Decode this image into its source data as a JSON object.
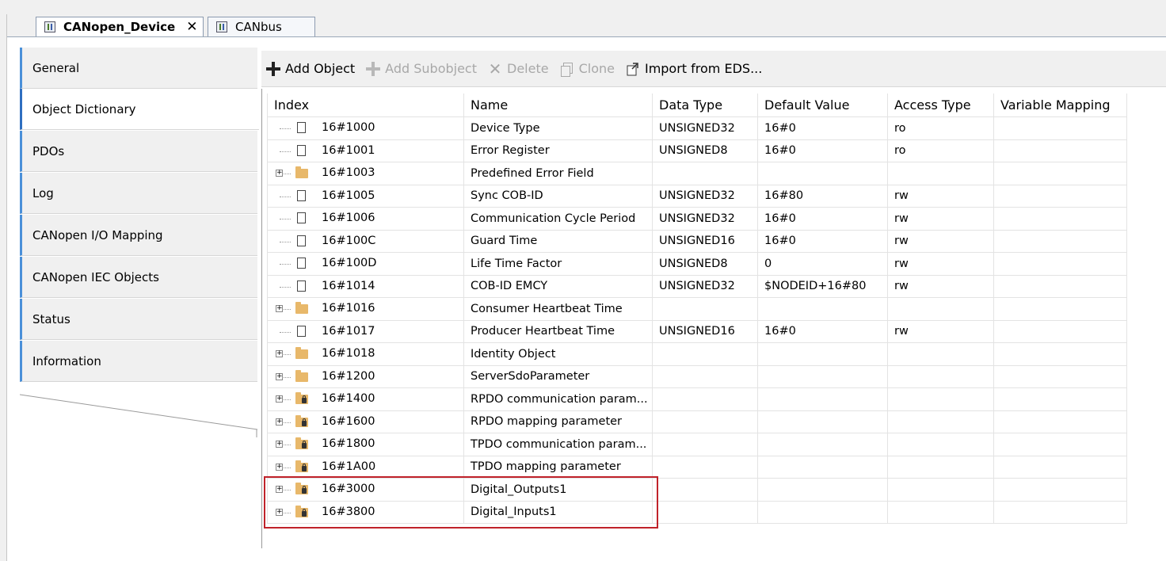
{
  "tabs": [
    {
      "label": "CANopen_Device",
      "close": "✕",
      "active": true
    },
    {
      "label": "CANbus",
      "active": false
    }
  ],
  "side_tabs": [
    {
      "label": "General"
    },
    {
      "label": "Object Dictionary",
      "active": true
    },
    {
      "label": "PDOs"
    },
    {
      "label": "Log"
    },
    {
      "label": "CANopen I/O Mapping"
    },
    {
      "label": "CANopen IEC Objects"
    },
    {
      "label": "Status"
    },
    {
      "label": "Information"
    }
  ],
  "toolbar": {
    "add_object": "Add Object",
    "add_subobject": "Add Subobject",
    "delete": "Delete",
    "clone": "Clone",
    "import_eds": "Import from EDS..."
  },
  "table": {
    "columns": [
      "Index",
      "Name",
      "Data Type",
      "Default Value",
      "Access Type",
      "Variable Mapping"
    ],
    "rows": [
      {
        "index": "16#1000",
        "name": "Device Type",
        "type": "UNSIGNED32",
        "default": "16#0",
        "access": "ro",
        "icon": "doc"
      },
      {
        "index": "16#1001",
        "name": "Error Register",
        "type": "UNSIGNED8",
        "default": "16#0",
        "access": "ro",
        "icon": "doc"
      },
      {
        "index": "16#1003",
        "name": "Predefined Error Field",
        "type": "",
        "default": "",
        "access": "",
        "icon": "folder"
      },
      {
        "index": "16#1005",
        "name": "Sync COB-ID",
        "type": "UNSIGNED32",
        "default": "16#80",
        "access": "rw",
        "icon": "doc"
      },
      {
        "index": "16#1006",
        "name": "Communication Cycle Period",
        "type": "UNSIGNED32",
        "default": "16#0",
        "access": "rw",
        "icon": "doc"
      },
      {
        "index": "16#100C",
        "name": "Guard Time",
        "type": "UNSIGNED16",
        "default": "16#0",
        "access": "rw",
        "icon": "doc"
      },
      {
        "index": "16#100D",
        "name": "Life Time Factor",
        "type": "UNSIGNED8",
        "default": "0",
        "access": "rw",
        "icon": "doc"
      },
      {
        "index": "16#1014",
        "name": "COB-ID EMCY",
        "type": "UNSIGNED32",
        "default": "$NODEID+16#80",
        "access": "rw",
        "icon": "doc"
      },
      {
        "index": "16#1016",
        "name": "Consumer Heartbeat Time",
        "type": "",
        "default": "",
        "access": "",
        "icon": "folder"
      },
      {
        "index": "16#1017",
        "name": "Producer Heartbeat Time",
        "type": "UNSIGNED16",
        "default": "16#0",
        "access": "rw",
        "icon": "doc"
      },
      {
        "index": "16#1018",
        "name": "Identity Object",
        "type": "",
        "default": "",
        "access": "",
        "icon": "folder"
      },
      {
        "index": "16#1200",
        "name": "ServerSdoParameter",
        "type": "",
        "default": "",
        "access": "",
        "icon": "folder"
      },
      {
        "index": "16#1400",
        "name": "RPDO communication param...",
        "type": "",
        "default": "",
        "access": "",
        "icon": "locked-folder"
      },
      {
        "index": "16#1600",
        "name": "RPDO mapping parameter",
        "type": "",
        "default": "",
        "access": "",
        "icon": "locked-folder"
      },
      {
        "index": "16#1800",
        "name": "TPDO communication param...",
        "type": "",
        "default": "",
        "access": "",
        "icon": "locked-folder"
      },
      {
        "index": "16#1A00",
        "name": "TPDO mapping parameter",
        "type": "",
        "default": "",
        "access": "",
        "icon": "locked-folder"
      },
      {
        "index": "16#3000",
        "name": "Digital_Outputs1",
        "type": "",
        "default": "",
        "access": "",
        "icon": "locked-folder"
      },
      {
        "index": "16#3800",
        "name": "Digital_Inputs1",
        "type": "",
        "default": "",
        "access": "",
        "icon": "locked-folder"
      }
    ]
  },
  "colors": {
    "highlight": "#c0222a",
    "side_accent": "#4a90d9",
    "folder": "#e8b86a"
  }
}
